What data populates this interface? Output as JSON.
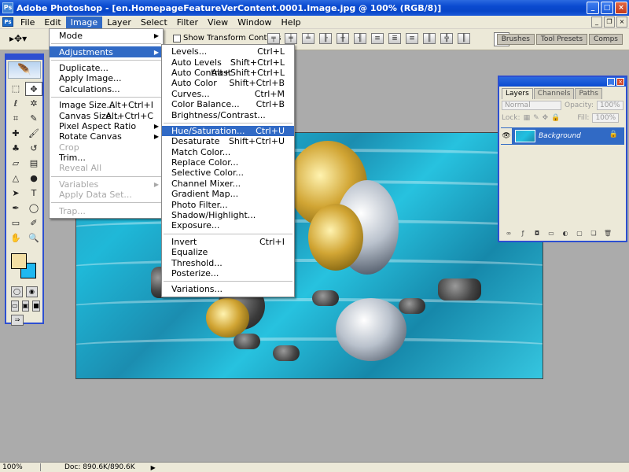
{
  "window": {
    "title": "Adobe Photoshop - [en.HomepageFeatureVerContent.0001.Image.jpg @ 100% (RGB/8)]",
    "app_icon": "Ps",
    "controls": [
      "_",
      "□",
      "×"
    ]
  },
  "menubar": {
    "items": [
      "File",
      "Edit",
      "Image",
      "Layer",
      "Select",
      "Filter",
      "View",
      "Window",
      "Help"
    ],
    "active": "Image"
  },
  "options_bar": {
    "show_transform_label": "Show Transform Controls",
    "palette_tabs": [
      "Brushes",
      "Tool Presets",
      "Comps"
    ]
  },
  "image_menu": {
    "items": [
      {
        "label": "Mode",
        "submenu": true
      },
      {
        "separator": true
      },
      {
        "label": "Adjustments",
        "submenu": true,
        "highlight": true
      },
      {
        "separator": true
      },
      {
        "label": "Duplicate..."
      },
      {
        "label": "Apply Image..."
      },
      {
        "label": "Calculations..."
      },
      {
        "separator": true
      },
      {
        "label": "Image Size...",
        "shortcut": "Alt+Ctrl+I"
      },
      {
        "label": "Canvas Size...",
        "shortcut": "Alt+Ctrl+C"
      },
      {
        "label": "Pixel Aspect Ratio",
        "submenu": true
      },
      {
        "label": "Rotate Canvas",
        "submenu": true
      },
      {
        "label": "Crop",
        "disabled": true
      },
      {
        "label": "Trim..."
      },
      {
        "label": "Reveal All",
        "disabled": true
      },
      {
        "separator": true
      },
      {
        "label": "Variables",
        "submenu": true,
        "disabled": true
      },
      {
        "label": "Apply Data Set...",
        "disabled": true
      },
      {
        "separator": true
      },
      {
        "label": "Trap...",
        "disabled": true
      }
    ]
  },
  "adjustments_menu": {
    "items": [
      {
        "label": "Levels...",
        "shortcut": "Ctrl+L"
      },
      {
        "label": "Auto Levels",
        "shortcut": "Shift+Ctrl+L"
      },
      {
        "label": "Auto Contrast",
        "shortcut": "Alt+Shift+Ctrl+L"
      },
      {
        "label": "Auto Color",
        "shortcut": "Shift+Ctrl+B"
      },
      {
        "label": "Curves...",
        "shortcut": "Ctrl+M"
      },
      {
        "label": "Color Balance...",
        "shortcut": "Ctrl+B"
      },
      {
        "label": "Brightness/Contrast..."
      },
      {
        "separator": true
      },
      {
        "label": "Hue/Saturation...",
        "shortcut": "Ctrl+U",
        "highlight": true
      },
      {
        "label": "Desaturate",
        "shortcut": "Shift+Ctrl+U"
      },
      {
        "label": "Match Color..."
      },
      {
        "label": "Replace Color..."
      },
      {
        "label": "Selective Color..."
      },
      {
        "label": "Channel Mixer..."
      },
      {
        "label": "Gradient Map..."
      },
      {
        "label": "Photo Filter..."
      },
      {
        "label": "Shadow/Highlight..."
      },
      {
        "label": "Exposure..."
      },
      {
        "separator": true
      },
      {
        "label": "Invert",
        "shortcut": "Ctrl+I"
      },
      {
        "label": "Equalize"
      },
      {
        "label": "Threshold..."
      },
      {
        "label": "Posterize..."
      },
      {
        "separator": true
      },
      {
        "label": "Variations..."
      }
    ]
  },
  "layers_panel": {
    "tabs": [
      "Layers",
      "Channels",
      "Paths"
    ],
    "active_tab": "Layers",
    "blend_mode": "Normal",
    "opacity_label": "Opacity:",
    "opacity_value": "100%",
    "lock_label": "Lock:",
    "fill_label": "Fill:",
    "fill_value": "100%",
    "layer_name": "Background"
  },
  "toolbox": {
    "foreground_color": "#f3dfa4",
    "background_color": "#1fb8f0"
  },
  "statusbar": {
    "zoom": "100%",
    "doc": "Doc: 890.6K/890.6K"
  }
}
